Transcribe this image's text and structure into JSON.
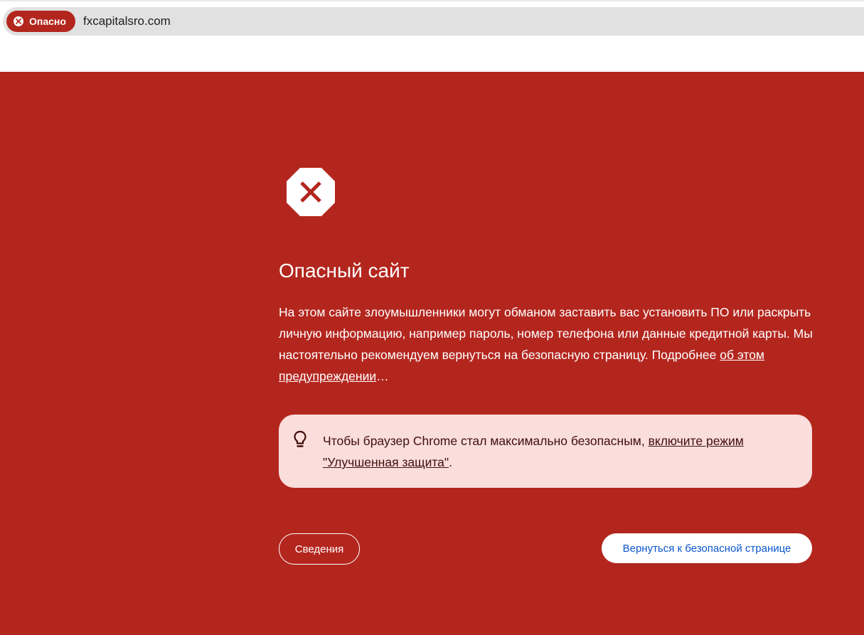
{
  "browser": {
    "security_chip_label": "Опасно",
    "url": "fxcapitalsro.com"
  },
  "colors": {
    "danger_background": "#b3261e",
    "tip_background": "#f9dedc",
    "primary_link": "#0b57d0"
  },
  "warning": {
    "icon": "danger-stop-icon",
    "title": "Опасный сайт",
    "body": "На этом сайте злоумышленники могут обманом заставить вас установить ПО или раскрыть личную информацию, например пароль, номер телефона или данные кредитной карты. Мы настоятельно рекомендуем вернуться на безопасную страницу. Подробнее",
    "learn_more_link": "об этом предупреждении",
    "learn_more_suffix": "…"
  },
  "tip": {
    "icon": "lightbulb-icon",
    "text": "Чтобы браузер Chrome стал максимально безопасным,",
    "link": "включите режим \"Улучшенная защита\"",
    "suffix": "."
  },
  "buttons": {
    "details": "Сведения",
    "back_to_safety": "Вернуться к безопасной странице"
  }
}
